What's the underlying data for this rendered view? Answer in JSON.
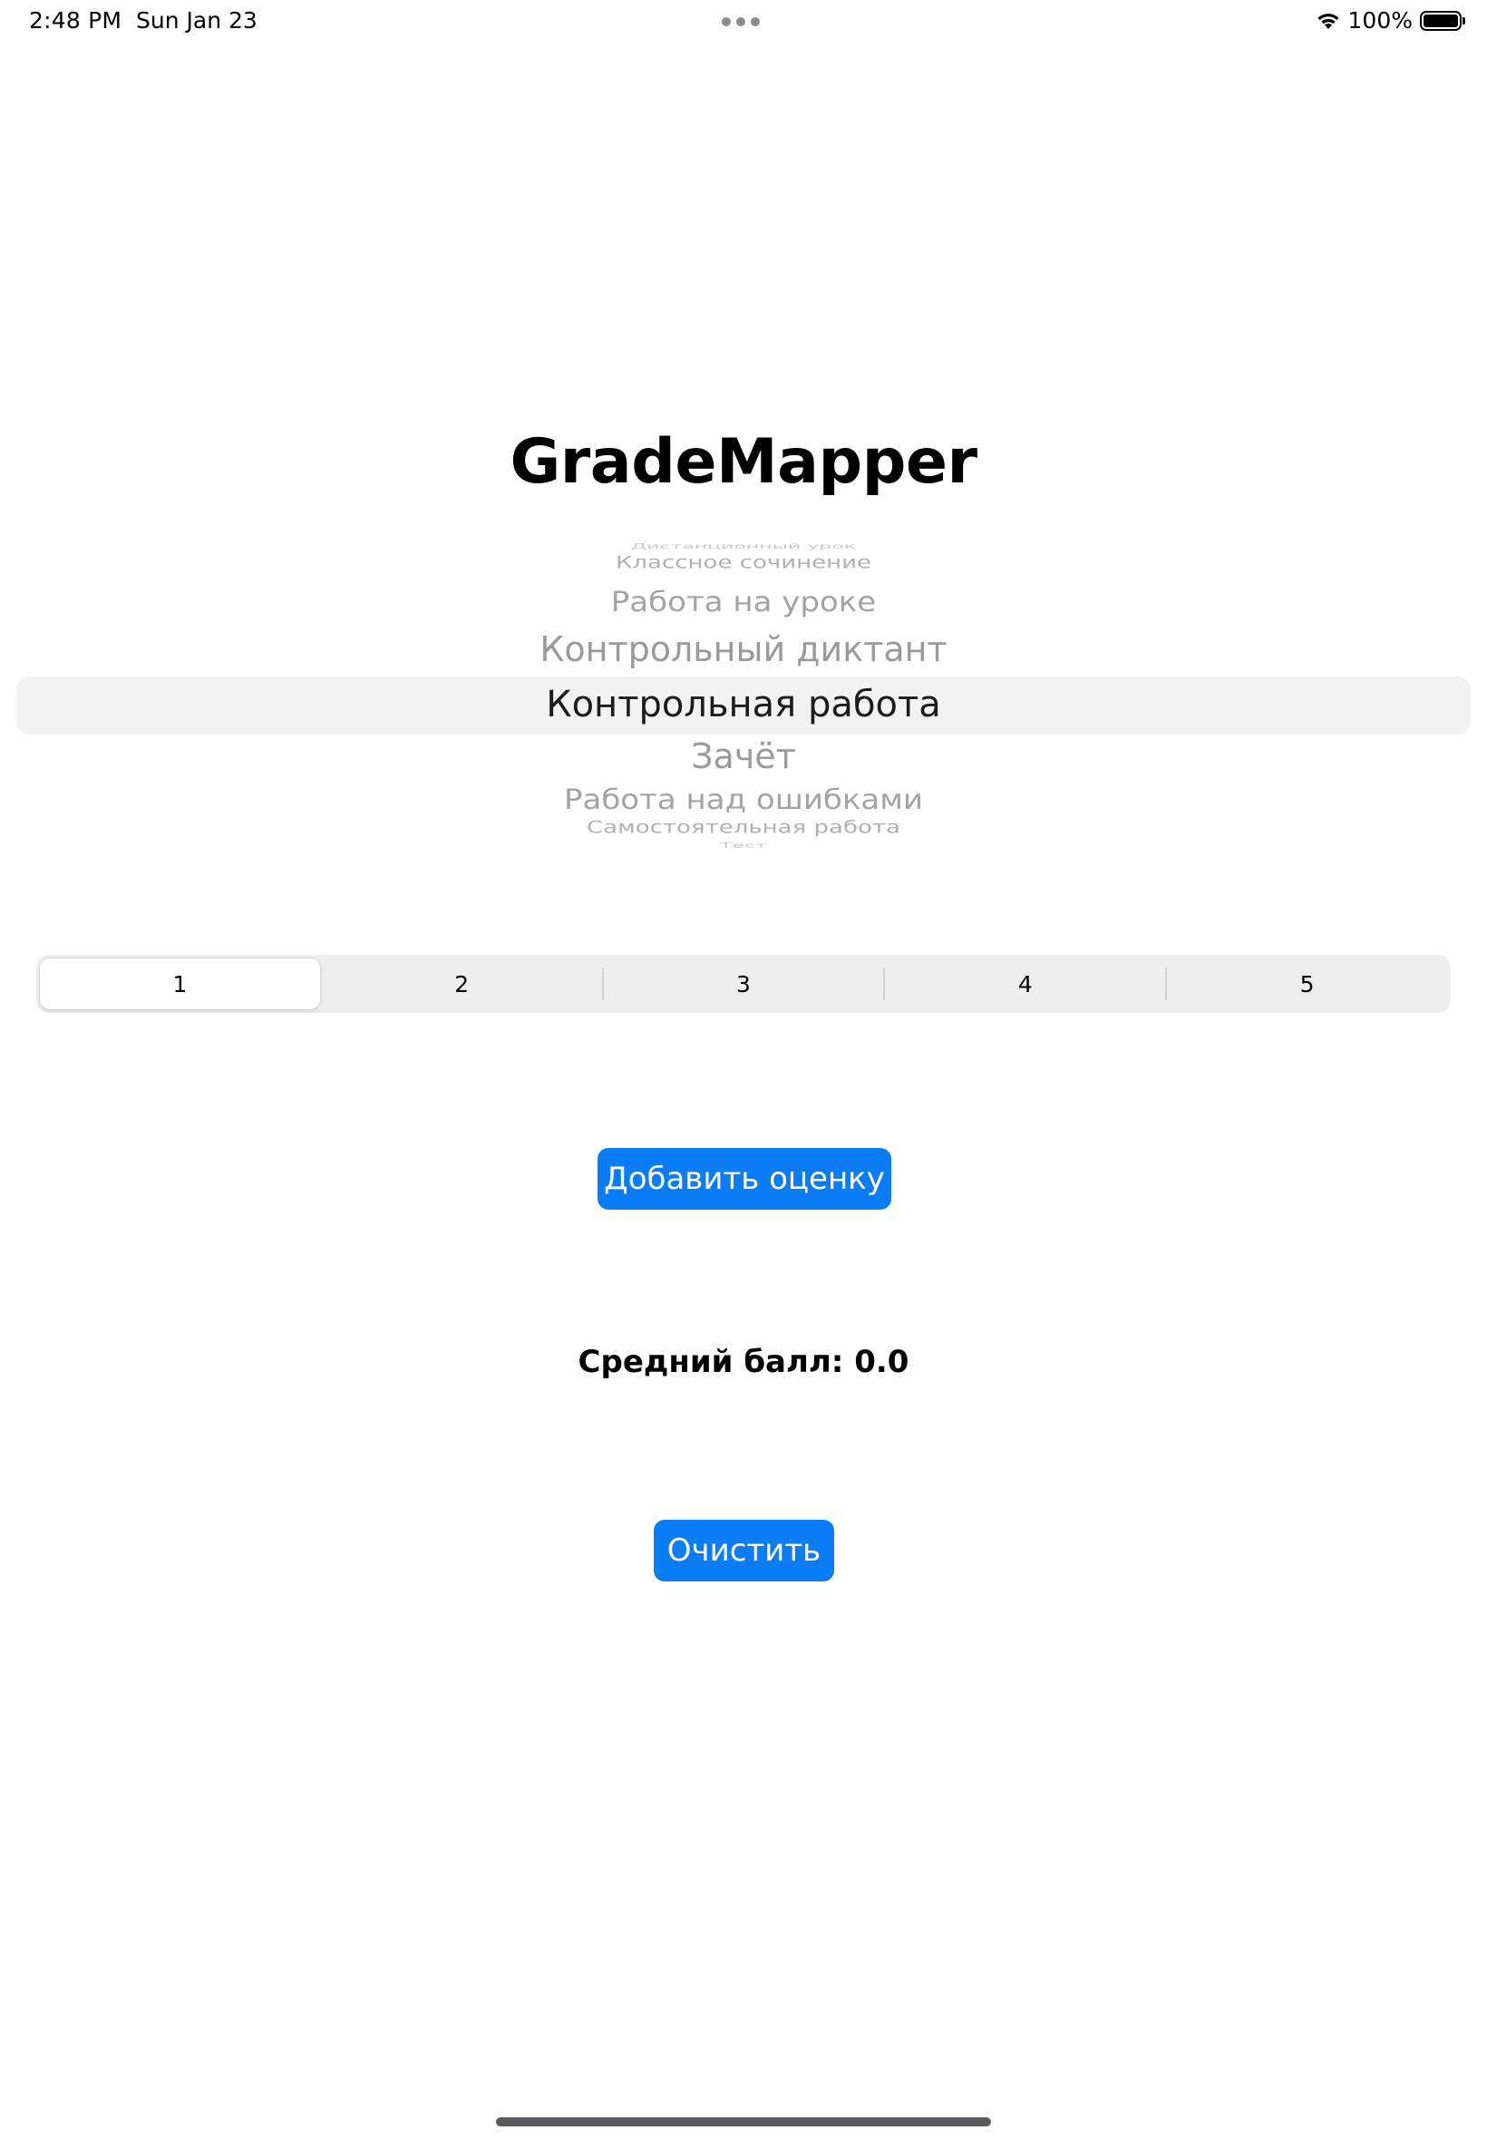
{
  "status_bar": {
    "time": "2:48 PM",
    "date": "Sun Jan 23",
    "battery_percent": "100%",
    "battery_level": 1.0,
    "icons": [
      "wifi-icon",
      "battery-icon",
      "multitasking-dots-icon"
    ]
  },
  "app": {
    "title": "GradeMapper"
  },
  "picker": {
    "items_above": [
      "Дистанционный урок",
      "Классное сочинение",
      "Работа на уроке",
      "Контрольный диктант"
    ],
    "selected": "Контрольная работа",
    "items_below": [
      "Зачёт",
      "Работа над ошибками",
      "Самостоятельная работа",
      "Тест"
    ]
  },
  "grade_segments": {
    "options": [
      "1",
      "2",
      "3",
      "4",
      "5"
    ],
    "selected_index": 0
  },
  "actions": {
    "add_label": "Добавить оценку",
    "clear_label": "Очистить"
  },
  "average": {
    "label": "Средний балл: 0.0"
  },
  "colors": {
    "accent": "#0a7cf5",
    "background": "#ffffff",
    "selection_band": "#f2f2f3"
  }
}
